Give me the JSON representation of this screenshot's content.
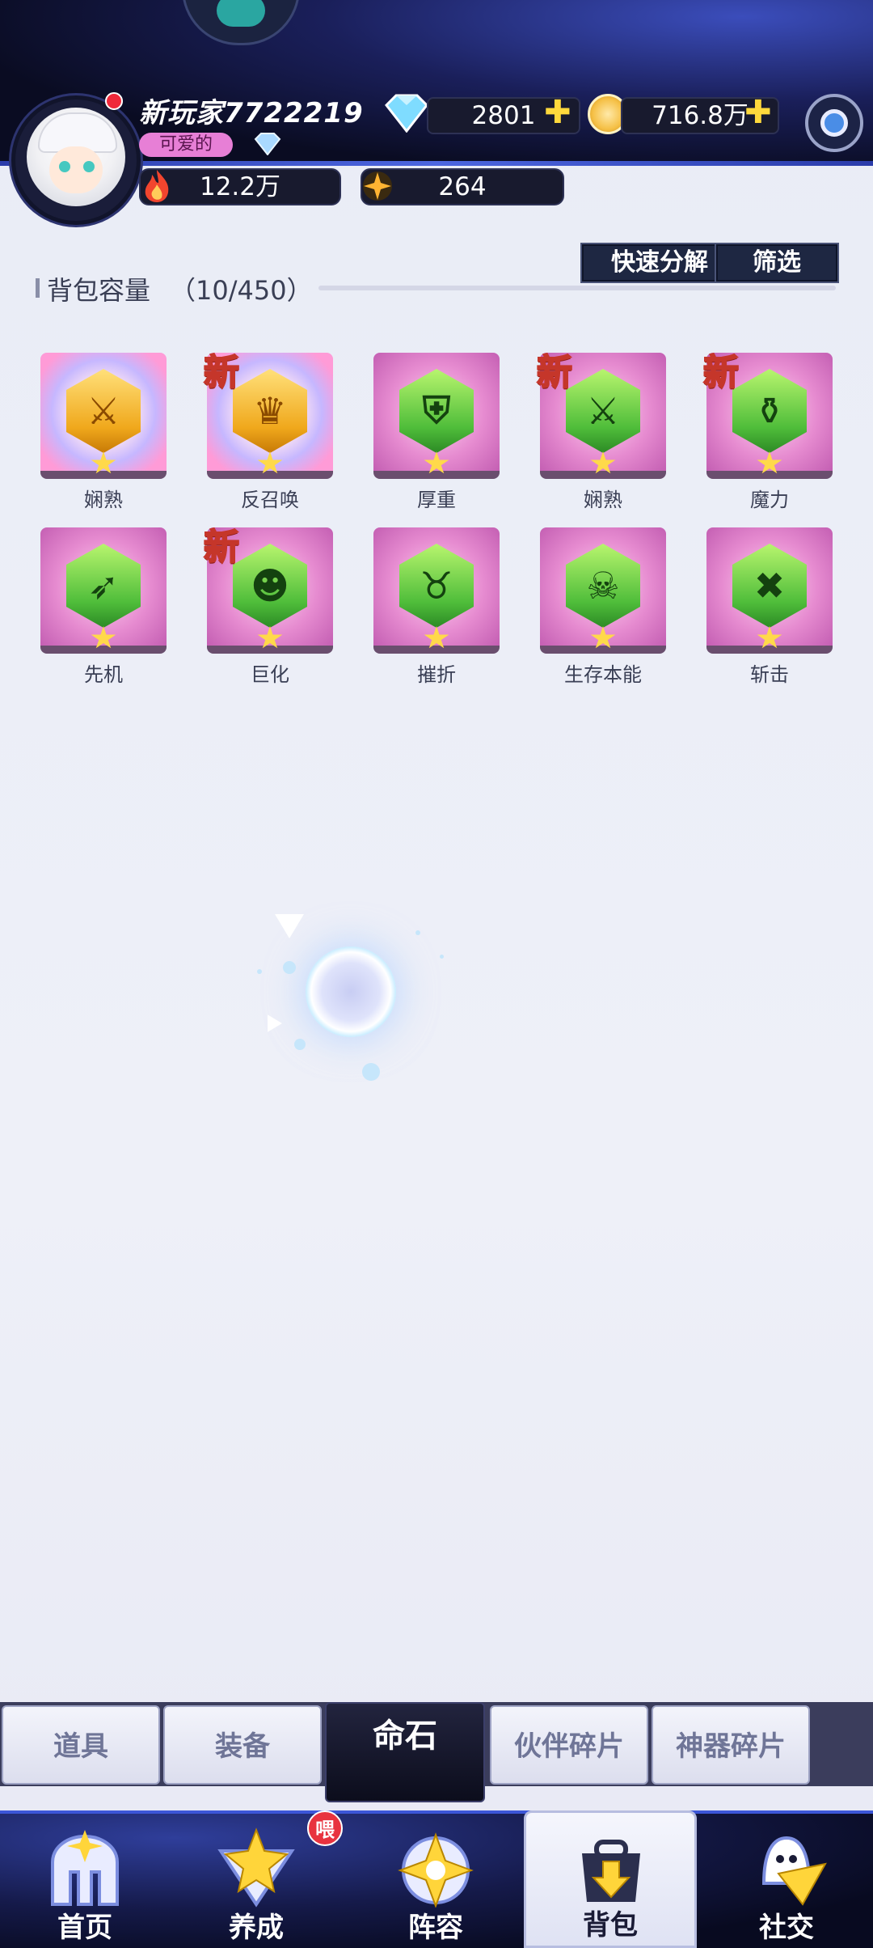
{
  "player": {
    "name": "新玩家7722219",
    "title_badge": "可爱的"
  },
  "resources": {
    "diamonds": "2801",
    "gold": "716.8万",
    "power": "12.2万",
    "energy": "264"
  },
  "backpack": {
    "capacity_label": "背包容量",
    "capacity_count": "（10/450）",
    "quick_decompose": "快速分解",
    "filter": "筛选",
    "new_tag": "新",
    "items": [
      {
        "name": "娴熟",
        "rarity": "gold",
        "icon": "sword-cross-icon",
        "is_new": false
      },
      {
        "name": "反召唤",
        "rarity": "gold",
        "icon": "crown-gem-icon",
        "is_new": true
      },
      {
        "name": "厚重",
        "rarity": "green",
        "icon": "shield-figure-icon",
        "is_new": false
      },
      {
        "name": "娴熟",
        "rarity": "green",
        "icon": "sword-cross-icon",
        "is_new": true
      },
      {
        "name": "魔力",
        "rarity": "green",
        "icon": "potion-icon",
        "is_new": true
      },
      {
        "name": "先机",
        "rarity": "green",
        "icon": "bow-arrow-icon",
        "is_new": false
      },
      {
        "name": "巨化",
        "rarity": "green",
        "icon": "monster-face-icon",
        "is_new": true
      },
      {
        "name": "摧折",
        "rarity": "green",
        "icon": "horned-demon-icon",
        "is_new": false
      },
      {
        "name": "生存本能",
        "rarity": "green",
        "icon": "skull-crossed-icon",
        "is_new": false
      },
      {
        "name": "斩击",
        "rarity": "green",
        "icon": "goblin-icon",
        "is_new": false
      }
    ]
  },
  "sub_tabs": [
    "道具",
    "装备",
    "命石",
    "伙伴碎片",
    "神器碎片"
  ],
  "sub_tab_active": "命石",
  "nav": {
    "items": [
      {
        "label": "首页",
        "icon": "castle-icon"
      },
      {
        "label": "养成",
        "icon": "star-triangle-icon",
        "badge": "喂"
      },
      {
        "label": "阵容",
        "icon": "compass-star-icon"
      },
      {
        "label": "背包",
        "icon": "bag-icon"
      },
      {
        "label": "社交",
        "icon": "ghost-mail-icon"
      }
    ],
    "active": "背包"
  },
  "colors": {
    "accent_gold": "#ffd93c",
    "tile_pink": "#e68bd0",
    "header_dark": "#0a0c22"
  }
}
